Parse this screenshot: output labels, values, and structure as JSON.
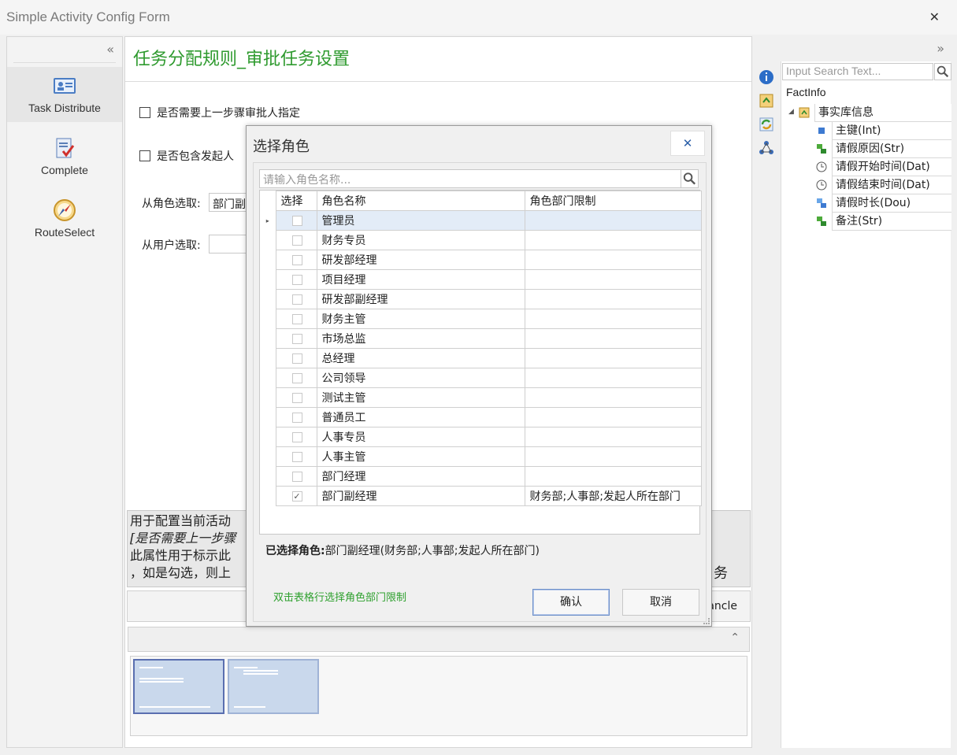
{
  "window": {
    "title": "Simple Activity Config Form",
    "close_glyph": "✕"
  },
  "leftnav": {
    "collapse_glyph": "«",
    "items": [
      {
        "label": "Task Distribute",
        "icon": "user-card-icon",
        "active": true
      },
      {
        "label": "Complete",
        "icon": "document-check-icon",
        "active": false
      },
      {
        "label": "RouteSelect",
        "icon": "compass-icon",
        "active": false
      }
    ]
  },
  "main": {
    "heading": "任务分配规则_审批任务设置",
    "check_prev_step": "是否需要上一步骤审批人指定",
    "check_include_initiator": "是否包含发起人",
    "role_label": "从角色选取:",
    "role_value": "部门副",
    "user_label": "从用户选取:",
    "user_value": "",
    "desc_line1": "用于配置当前活动",
    "desc_line2": "[是否需要上一步骤",
    "desc_line3": "此属性用于标示此",
    "desc_line4": "，如是勾选，则上",
    "desc_right_word": "务",
    "cancel_partial": "ancle",
    "pager_glyph": "⌃"
  },
  "rightpanel": {
    "expand_glyph": "»",
    "search_placeholder": "Input Search Text...",
    "factinfo_label": "FactInfo",
    "root": {
      "label": "事实库信息",
      "icon": "fact-library-icon"
    },
    "fields": [
      {
        "label": "主键(Int)",
        "icon": "blue-square-icon"
      },
      {
        "label": "请假原因(Str)",
        "icon": "green-blocks-icon"
      },
      {
        "label": "请假开始时间(Dat)",
        "icon": "clock-icon"
      },
      {
        "label": "请假结束时间(Dat)",
        "icon": "clock-icon"
      },
      {
        "label": "请假时长(Dou)",
        "icon": "blue-blocks-icon"
      },
      {
        "label": "备注(Str)",
        "icon": "green-blocks-icon"
      }
    ]
  },
  "dialog": {
    "title": "选择角色",
    "close_glyph": "✕",
    "search_placeholder": "请输入角色名称...",
    "columns": {
      "select": "选择",
      "role_name": "角色名称",
      "dept_limit": "角色部门限制"
    },
    "rows": [
      {
        "name": "管理员",
        "checked": false,
        "limit": ""
      },
      {
        "name": "财务专员",
        "checked": false,
        "limit": ""
      },
      {
        "name": "研发部经理",
        "checked": false,
        "limit": ""
      },
      {
        "name": "项目经理",
        "checked": false,
        "limit": ""
      },
      {
        "name": "研发部副经理",
        "checked": false,
        "limit": ""
      },
      {
        "name": "财务主管",
        "checked": false,
        "limit": ""
      },
      {
        "name": "市场总监",
        "checked": false,
        "limit": ""
      },
      {
        "name": "总经理",
        "checked": false,
        "limit": ""
      },
      {
        "name": "公司领导",
        "checked": false,
        "limit": ""
      },
      {
        "name": "测试主管",
        "checked": false,
        "limit": ""
      },
      {
        "name": "普通员工",
        "checked": false,
        "limit": ""
      },
      {
        "name": "人事专员",
        "checked": false,
        "limit": ""
      },
      {
        "name": "人事主管",
        "checked": false,
        "limit": ""
      },
      {
        "name": "部门经理",
        "checked": false,
        "limit": ""
      },
      {
        "name": "部门副经理",
        "checked": true,
        "limit": "财务部;人事部;发起人所在部门"
      }
    ],
    "selected_label": "已选择角色:",
    "selected_value": "部门副经理(财务部;人事部;发起人所在部门)",
    "hint": "双击表格行选择角色部门限制",
    "ok_label": "确认",
    "cancel_label": "取消",
    "row_indicator_glyph": "▸",
    "check_glyph": "✓"
  }
}
